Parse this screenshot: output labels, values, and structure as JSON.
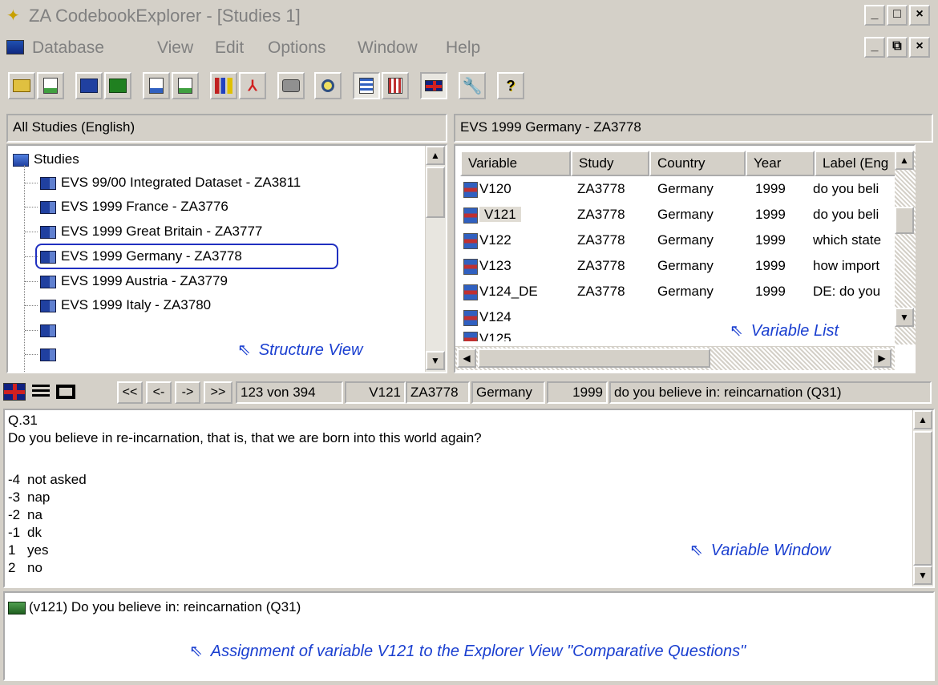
{
  "window": {
    "title": "ZA CodebookExplorer - [Studies 1]",
    "min_glyph": "_",
    "max_glyph": "□",
    "close_glyph": "×",
    "restore_glyph": "⧉"
  },
  "menu": [
    "Database",
    "View",
    "Edit",
    "Options",
    "Window",
    "Help"
  ],
  "toolbar_icons": [
    "open-folder-icon",
    "report-icon",
    "blue-book-icon",
    "green-book-icon",
    "report2-icon",
    "report3-icon",
    "chart-icon",
    "pdf-icon",
    "print-icon",
    "search-icon",
    "list-view-icon",
    "grid-view-icon",
    "flag-uk-icon",
    "settings-icon",
    "help-icon"
  ],
  "structure_view": {
    "header": "All Studies (English)",
    "root_label": "Studies",
    "items": [
      "EVS 99/00  Integrated Dataset  - ZA3811",
      "EVS 1999  France  - ZA3776",
      "EVS 1999  Great Britain  - ZA3777",
      "EVS 1999  Germany  - ZA3778",
      "EVS 1999  Austria  - ZA3779",
      "EVS 1999  Italy  - ZA3780"
    ],
    "annotation": "Structure View"
  },
  "variable_list": {
    "header": "EVS 1999  Germany  - ZA3778",
    "columns": [
      "Variable",
      "Study",
      "Country",
      "Year",
      "Label (Eng"
    ],
    "rows": [
      [
        "V120",
        "ZA3778",
        "Germany",
        "1999",
        "do you beli"
      ],
      [
        "V121",
        "ZA3778",
        "Germany",
        "1999",
        "do you beli"
      ],
      [
        "V122",
        "ZA3778",
        "Germany",
        "1999",
        "which state"
      ],
      [
        "V123",
        "ZA3778",
        "Germany",
        "1999",
        "how import"
      ],
      [
        "V124_DE",
        "ZA3778",
        "Germany",
        "1999",
        "DE: do you"
      ],
      [
        "V124",
        "",
        "",
        "",
        ""
      ],
      [
        "V125",
        "",
        "",
        "",
        ""
      ]
    ],
    "annotation": "Variable List"
  },
  "navbar": {
    "first": "<<",
    "prev": "<-",
    "next": "->",
    "last": ">>",
    "position": "123 von 394",
    "variable": "V121",
    "study": "ZA3778",
    "country": "Germany",
    "year": "1999",
    "label": "do you believe in: reincarnation (Q31)"
  },
  "variable_window": {
    "question_id": "Q.31",
    "question_text": "Do you believe in re-incarnation, that is, that we are born into this world again?",
    "codes": [
      [
        "-4",
        "not asked"
      ],
      [
        "-3",
        "nap"
      ],
      [
        "-2",
        "na"
      ],
      [
        "-1",
        "dk"
      ],
      [
        "1",
        "yes"
      ],
      [
        "2",
        "no"
      ]
    ],
    "annotation": "Variable Window"
  },
  "assignment": {
    "entry": "(v121)  Do you believe in: reincarnation (Q31)",
    "annotation": "Assignment of variable V121 to the Explorer View \"Comparative Questions\""
  },
  "colors": {
    "face": "#d4d0c8",
    "annotation": "#1a3fd0",
    "highlight_ring": "#2030c0"
  }
}
